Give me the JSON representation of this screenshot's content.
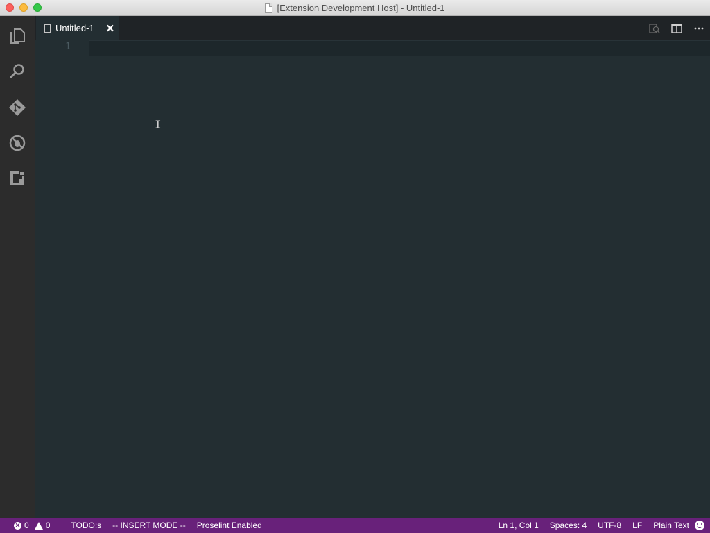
{
  "window": {
    "title": "[Extension Development Host] - Untitled-1"
  },
  "activity_bar": {
    "items": [
      {
        "icon": "files-icon"
      },
      {
        "icon": "search-icon"
      },
      {
        "icon": "source-control-icon"
      },
      {
        "icon": "debug-icon"
      },
      {
        "icon": "extensions-icon"
      }
    ]
  },
  "tabs": [
    {
      "label": "Untitled-1",
      "close": "✕"
    }
  ],
  "editor": {
    "line_numbers": [
      "1"
    ],
    "content": ""
  },
  "status_bar": {
    "errors": "0",
    "warnings": "0",
    "todo": "TODO:s",
    "mode": "-- INSERT MODE --",
    "proselint": "Proselint Enabled",
    "position": "Ln 1, Col 1",
    "indent": "Spaces: 4",
    "encoding": "UTF-8",
    "eol": "LF",
    "language": "Plain Text",
    "feedback_icon": "smiley-icon"
  },
  "colors": {
    "status_bar": "#68217a",
    "editor_bg": "#232e32",
    "activity_bar_bg": "#2c2c2c"
  }
}
